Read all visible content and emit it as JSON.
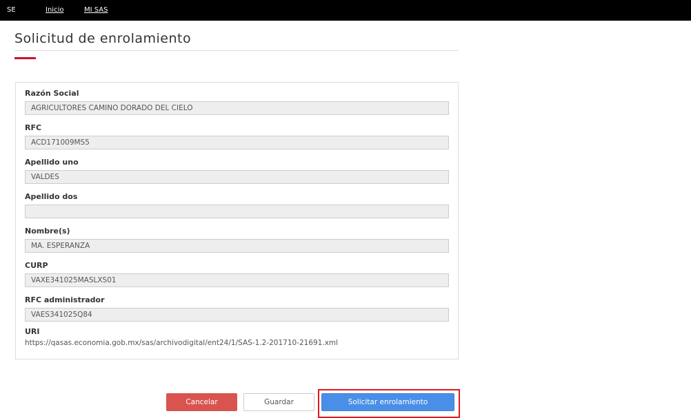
{
  "topbar": {
    "brand": "SE",
    "links": [
      "Inicio",
      "MI SAS"
    ]
  },
  "page": {
    "title": "Solicitud de enrolamiento"
  },
  "form": {
    "fields": [
      {
        "label": "Razón Social",
        "value": "AGRICULTORES CAMINO DORADO DEL CIELO"
      },
      {
        "label": "RFC",
        "value": "ACD171009MS5"
      },
      {
        "label": "Apellido uno",
        "value": "VALDES"
      },
      {
        "label": "Apellido dos",
        "value": ""
      },
      {
        "label": "Nombre(s)",
        "value": "MA. ESPERANZA"
      },
      {
        "label": "CURP",
        "value": "VAXE341025MASLXS01"
      },
      {
        "label": "RFC administrador",
        "value": "VAES341025Q84"
      }
    ],
    "uri": {
      "label": "URI",
      "value": "https://qasas.economia.gob.mx/sas/archivodigital/ent24/1/SAS-1.2-201710-21691.xml"
    }
  },
  "actions": {
    "cancel": "Cancelar",
    "save": "Guardar",
    "request": "Solicitar enrolamiento"
  },
  "colors": {
    "topbar": "#000000",
    "accent": "#c8102e",
    "cancel": "#d9534f",
    "primary": "#4a8fe7",
    "highlight": "#e2161c"
  }
}
